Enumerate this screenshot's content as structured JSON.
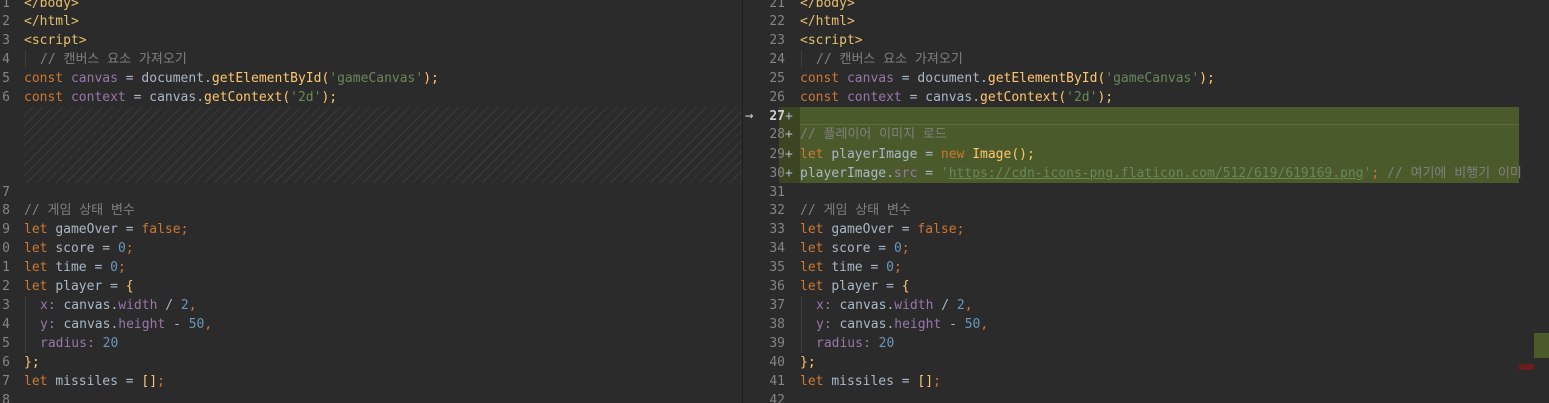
{
  "left_pane": {
    "line_numbers": [
      "1",
      "2",
      "3",
      "4",
      "5",
      "6",
      "7",
      "8",
      "9",
      "0",
      "1",
      "2",
      "3",
      "4",
      "5",
      "6",
      "7",
      "8"
    ]
  },
  "right_pane": {
    "line_numbers": [
      "21",
      "22",
      "23",
      "24",
      "25",
      "26",
      "27",
      "28",
      "29",
      "30",
      "31",
      "32",
      "33",
      "34",
      "35",
      "36",
      "37",
      "38",
      "39",
      "40",
      "41",
      "42"
    ],
    "added_marker": "+",
    "arrow": "→"
  },
  "tokens": {
    "body_close": "</body>",
    "html_close": "</html>",
    "script_open": "<script>",
    "comment_canvas": "// 캔버스 요소 가져오기",
    "const": "const",
    "canvas": "canvas",
    "context": "context",
    "eq": " = ",
    "document": "document.",
    "getElementById": "getElementById",
    "paren_open": "(",
    "paren_close_semi": ");",
    "str_gameCanvas": "'gameCanvas'",
    "canvas_dot": "canvas.",
    "getContext": "getContext",
    "str_2d": "'2d'",
    "comment_player_img": "// 플레이어 이미지 로드",
    "let": "let",
    "playerImage": "playerImage",
    "new": "new",
    "Image": "Image",
    "call_semi": "();",
    "playerImage_dot": "playerImage.",
    "src": "src",
    "str_url_q1": "'",
    "url": "https://cdn-icons-png.flaticon.com/512/619/619169.png",
    "str_url_q2": "'",
    "semi": ";",
    "comment_airplane": " // 여기에 비행기 이미",
    "comment_state": "// 게임 상태 변수",
    "gameOver": "gameOver",
    "false": "false",
    "score": "score",
    "zero": "0",
    "time": "time",
    "player": "player",
    "brace_open": "{",
    "x_key": "x",
    "colon": ": ",
    "width": "width",
    "div": " / ",
    "two": "2",
    "comma": ",",
    "y_key": "y",
    "height": "height",
    "minus": " - ",
    "fifty": "50",
    "radius": "radius",
    "twenty": "20",
    "brace_close_semi": "};",
    "missiles": "missiles",
    "array_empty": "[]"
  }
}
